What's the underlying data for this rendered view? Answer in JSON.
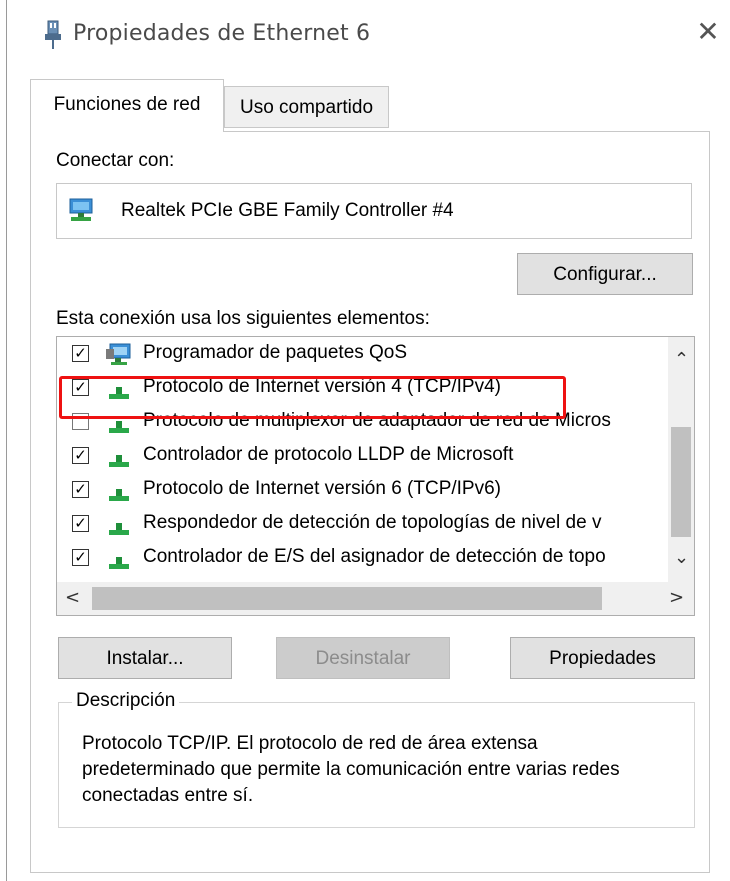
{
  "window": {
    "title": "Propiedades de Ethernet 6",
    "close_symbol": "✕"
  },
  "tabs": [
    {
      "label": "Funciones de red",
      "active": true
    },
    {
      "label": "Uso compartido",
      "active": false
    }
  ],
  "connect": {
    "label": "Conectar con:",
    "adapter": "Realtek PCIe GBE Family Controller #4",
    "configure_button": "Configurar..."
  },
  "elements": {
    "label": "Esta conexión usa los siguientes elementos:",
    "items": [
      {
        "label": "Programador de paquetes QoS",
        "checked": true,
        "icon": "qos-scheduler-icon"
      },
      {
        "label": "Protocolo de Internet versión 4 (TCP/IPv4)",
        "checked": true,
        "icon": "network-protocol-icon"
      },
      {
        "label": "Protocolo de multiplexor de adaptador de red de Micros",
        "checked": false,
        "icon": "network-protocol-icon"
      },
      {
        "label": "Controlador de protocolo LLDP de Microsoft",
        "checked": true,
        "icon": "network-protocol-icon"
      },
      {
        "label": "Protocolo de Internet versión 6 (TCP/IPv6)",
        "checked": true,
        "icon": "network-protocol-icon"
      },
      {
        "label": "Respondedor de detección de topologías de nivel de v",
        "checked": true,
        "icon": "network-protocol-icon"
      },
      {
        "label": "Controlador de E/S del asignador de detección de topo",
        "checked": true,
        "icon": "network-protocol-icon"
      }
    ],
    "highlight_color": "#ee1111"
  },
  "buttons": {
    "install": "Instalar...",
    "uninstall": "Desinstalar",
    "properties": "Propiedades"
  },
  "description": {
    "legend": "Descripción",
    "text": "Protocolo TCP/IP. El protocolo de red de área extensa predeterminado que permite la comunicación entre varias redes conectadas entre sí."
  }
}
